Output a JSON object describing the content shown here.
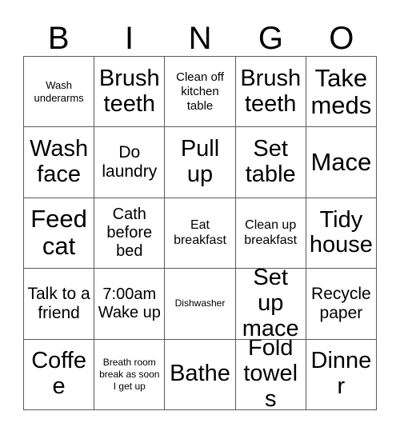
{
  "header": {
    "letters": [
      "B",
      "I",
      "N",
      "G",
      "O"
    ]
  },
  "grid": {
    "rows": 5,
    "columns": 5,
    "border_color": "#5a5a5a",
    "background_color": "#ffffff",
    "text_color": "#000000",
    "cells": [
      {
        "text": "Wash underarms",
        "size": "fs-sm"
      },
      {
        "text": "Brush teeth",
        "size": "fs-xxl"
      },
      {
        "text": "Clean off kitchen table",
        "size": "fs-md"
      },
      {
        "text": "Brush teeth",
        "size": "fs-xxl"
      },
      {
        "text": "Take meds",
        "size": "fs-huge"
      },
      {
        "text": "Wash face",
        "size": "fs-xxl"
      },
      {
        "text": "Do laundry",
        "size": "fs-xl"
      },
      {
        "text": "Pull up",
        "size": "fs-xxl"
      },
      {
        "text": "Set table",
        "size": "fs-xxl"
      },
      {
        "text": "Mace",
        "size": "fs-huge"
      },
      {
        "text": "Feed cat",
        "size": "fs-huge"
      },
      {
        "text": "Cath before bed",
        "size": "fs-lg"
      },
      {
        "text": "Eat breakfast",
        "size": "fs-ml"
      },
      {
        "text": "Clean up breakfast",
        "size": "fs-ml"
      },
      {
        "text": "Tidy house",
        "size": "fs-xxl"
      },
      {
        "text": "Talk to a friend",
        "size": "fs-xl"
      },
      {
        "text": "7:00am Wake up",
        "size": "fs-lg"
      },
      {
        "text": "Dishwasher",
        "size": "fs-xs"
      },
      {
        "text": "Set up mace",
        "size": "fs-xxl"
      },
      {
        "text": "Recycle paper",
        "size": "fs-xl"
      },
      {
        "text": "Coffee",
        "size": "fs-xxl"
      },
      {
        "text": "Breath room break as soon I get up",
        "size": "fs-xs"
      },
      {
        "text": "Bathe",
        "size": "fs-xxl"
      },
      {
        "text": "Fold towels",
        "size": "fs-xxl"
      },
      {
        "text": "Dinner",
        "size": "fs-xxl"
      }
    ]
  }
}
